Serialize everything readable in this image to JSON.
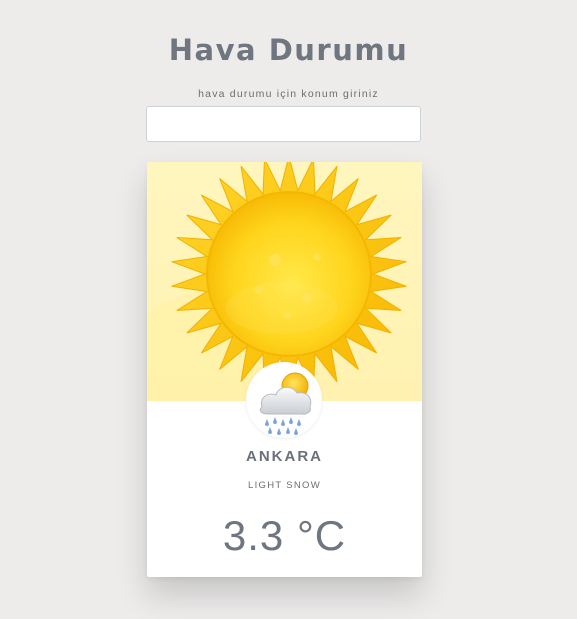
{
  "page": {
    "title": "Hava Durumu",
    "hint": "hava durumu için konum giriniz"
  },
  "search": {
    "value": "",
    "placeholder": ""
  },
  "weather": {
    "city": "ANKARA",
    "description": "LIGHT SNOW",
    "temperature": "3.3 °C",
    "hero_icon": "sun-icon",
    "condition_icon": "sun-cloud-rain-icon"
  },
  "colors": {
    "background": "#edeceb",
    "title": "#6f7680",
    "hero_background": "#fff6bf",
    "sun": "#ffd21f"
  }
}
